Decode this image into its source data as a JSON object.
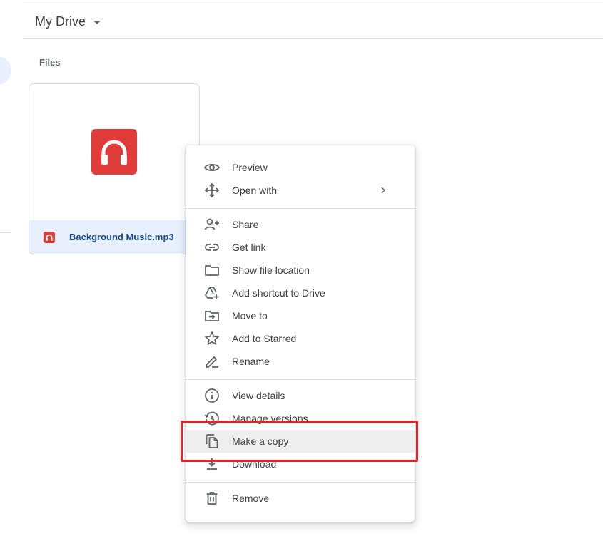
{
  "header": {
    "drive_title": "My Drive"
  },
  "files_section": {
    "label": "Files",
    "files": [
      {
        "name": "Background Music.mp3",
        "icon": "headphones-icon",
        "color": "#e03d3a"
      }
    ]
  },
  "context_menu": {
    "groups": [
      [
        {
          "label": "Preview",
          "icon": "eye-icon"
        },
        {
          "label": "Open with",
          "icon": "move-arrows-icon",
          "has_submenu": true
        }
      ],
      [
        {
          "label": "Share",
          "icon": "person-add-icon"
        },
        {
          "label": "Get link",
          "icon": "link-icon"
        },
        {
          "label": "Show file location",
          "icon": "folder-icon"
        },
        {
          "label": "Add shortcut to Drive",
          "icon": "drive-shortcut-icon"
        },
        {
          "label": "Move to",
          "icon": "folder-move-icon"
        },
        {
          "label": "Add to Starred",
          "icon": "star-icon"
        },
        {
          "label": "Rename",
          "icon": "pencil-icon"
        }
      ],
      [
        {
          "label": "View details",
          "icon": "info-icon"
        },
        {
          "label": "Manage versions",
          "icon": "history-icon"
        },
        {
          "label": "Make a copy",
          "icon": "copy-icon",
          "highlighted": true
        },
        {
          "label": "Download",
          "icon": "download-icon"
        }
      ],
      [
        {
          "label": "Remove",
          "icon": "trash-icon"
        }
      ]
    ]
  },
  "annotation": {
    "target": "Make a copy",
    "color": "#e32328"
  }
}
